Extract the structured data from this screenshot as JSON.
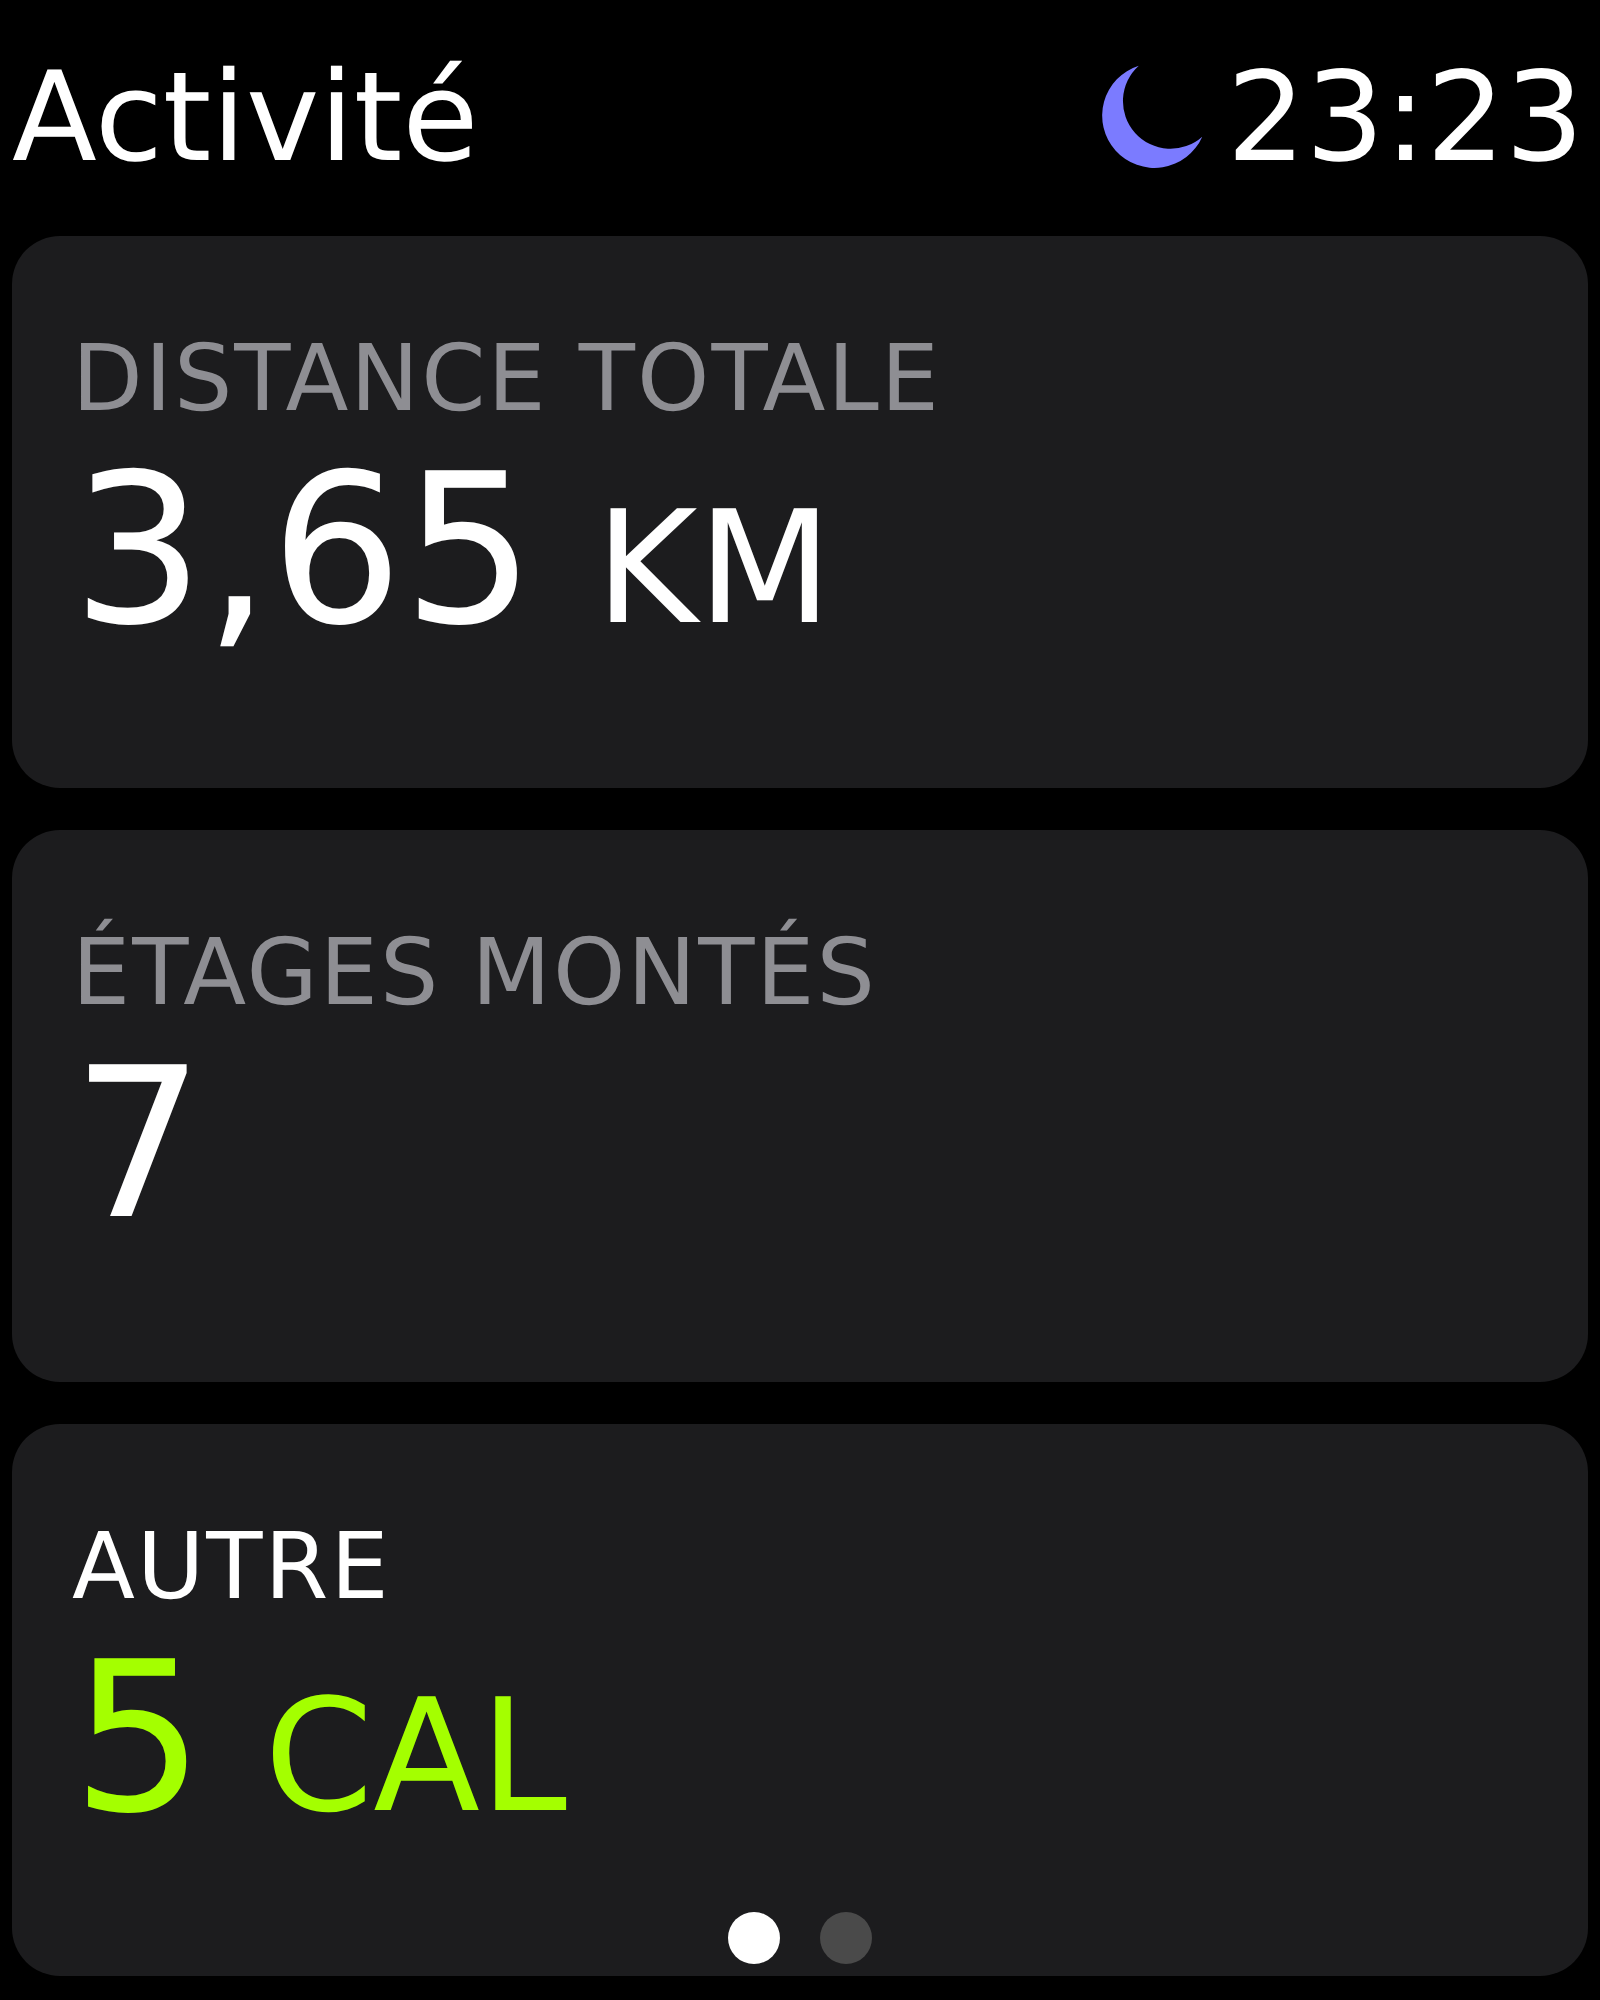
{
  "header": {
    "title": "Activité",
    "do_not_disturb": true,
    "time": "23:23"
  },
  "cards": [
    {
      "label": "DISTANCE TOTALE",
      "value": "3,65",
      "unit": "KM",
      "kind": "plain",
      "color": "#ffffff"
    },
    {
      "label": "ÉTAGES MONTÉS",
      "value": "7",
      "kind": "plain",
      "color": "#ffffff"
    },
    {
      "label": "AUTRE",
      "value": "5",
      "unit": "CAL",
      "kind": "highlight",
      "color": "#a4ff00"
    }
  ],
  "page_dots": [
    {
      "selected": true
    },
    {
      "selected": false
    }
  ]
}
